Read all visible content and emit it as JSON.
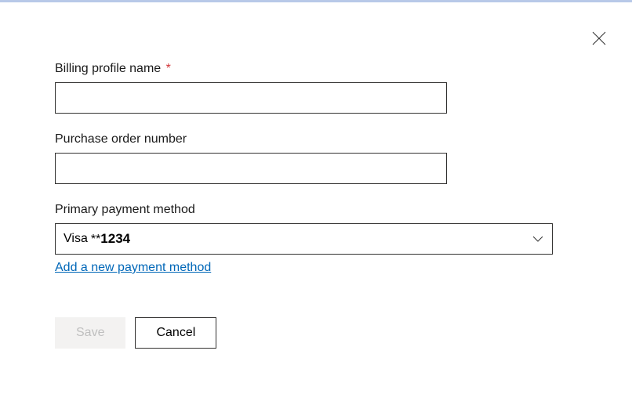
{
  "close_label": "Close",
  "form": {
    "billing_profile": {
      "label": "Billing profile name",
      "required_mark": "*",
      "value": ""
    },
    "purchase_order": {
      "label": "Purchase order number",
      "value": ""
    },
    "payment_method": {
      "label": "Primary payment method",
      "card_type": "Visa",
      "mask": "**",
      "last4": "1234",
      "add_new_link": "Add a new payment method"
    }
  },
  "buttons": {
    "save": "Save",
    "cancel": "Cancel"
  }
}
